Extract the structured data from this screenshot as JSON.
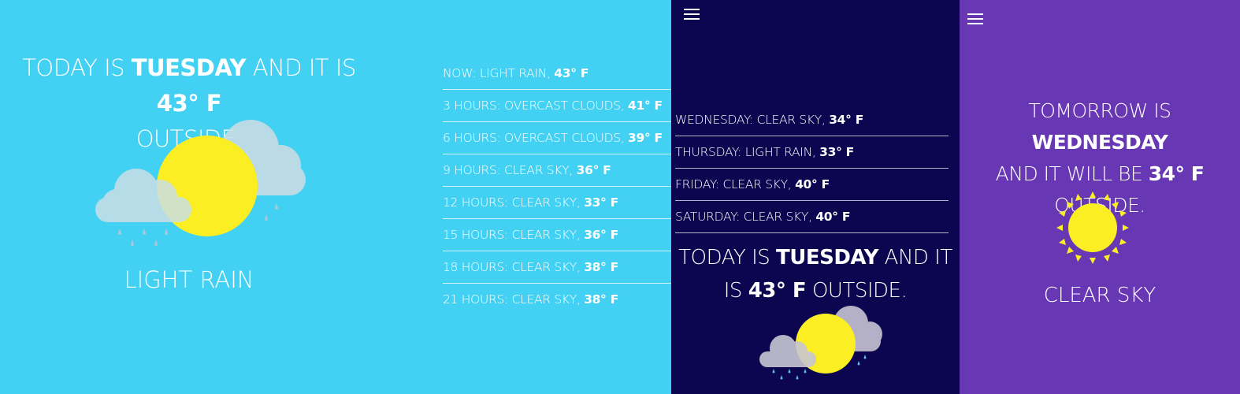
{
  "today": {
    "prefix": "Today is ",
    "day": "Tuesday",
    "middle": " and it is ",
    "temp": "43° F",
    "suffix": " outside.",
    "condition": "Light rain",
    "icon": "sun-cloud-rain-icon"
  },
  "hourly": [
    {
      "label": "Now: light rain, ",
      "temp": "43° F"
    },
    {
      "label": "3 hours: overcast clouds, ",
      "temp": "41° F"
    },
    {
      "label": "6 hours: overcast clouds, ",
      "temp": "39° F"
    },
    {
      "label": "9 hours: clear sky, ",
      "temp": "36° F"
    },
    {
      "label": "12 hours: clear sky, ",
      "temp": "33° F"
    },
    {
      "label": "15 hours: clear sky, ",
      "temp": "36° F"
    },
    {
      "label": "18 hours: clear sky, ",
      "temp": "38° F"
    },
    {
      "label": "21 hours: clear sky, ",
      "temp": "38° F"
    }
  ],
  "daily": [
    {
      "label": "Wednesday: clear sky, ",
      "temp": "34° F"
    },
    {
      "label": "Thursday: light rain, ",
      "temp": "33° F"
    },
    {
      "label": "Friday: clear sky, ",
      "temp": "40° F"
    },
    {
      "label": "Saturday: clear sky, ",
      "temp": "40° F"
    }
  ],
  "mobile_today": {
    "prefix": "Today is ",
    "day": "Tuesday",
    "middle": " and it is ",
    "temp": "43° F",
    "suffix": " outside.",
    "icon": "sun-cloud-rain-icon"
  },
  "tomorrow": {
    "prefix": "Tomorrow is ",
    "day": "Wednesday",
    "middle": " and it will be ",
    "temp": "34° F",
    "suffix": " outside.",
    "condition": "Clear sky",
    "icon": "sun-icon"
  },
  "menu_icon": "hamburger-menu-icon",
  "colors": {
    "panel_light": "#43d1f3",
    "panel_dark": "#0c0650",
    "panel_purple": "#6838b4",
    "sun": "#fbee23"
  }
}
